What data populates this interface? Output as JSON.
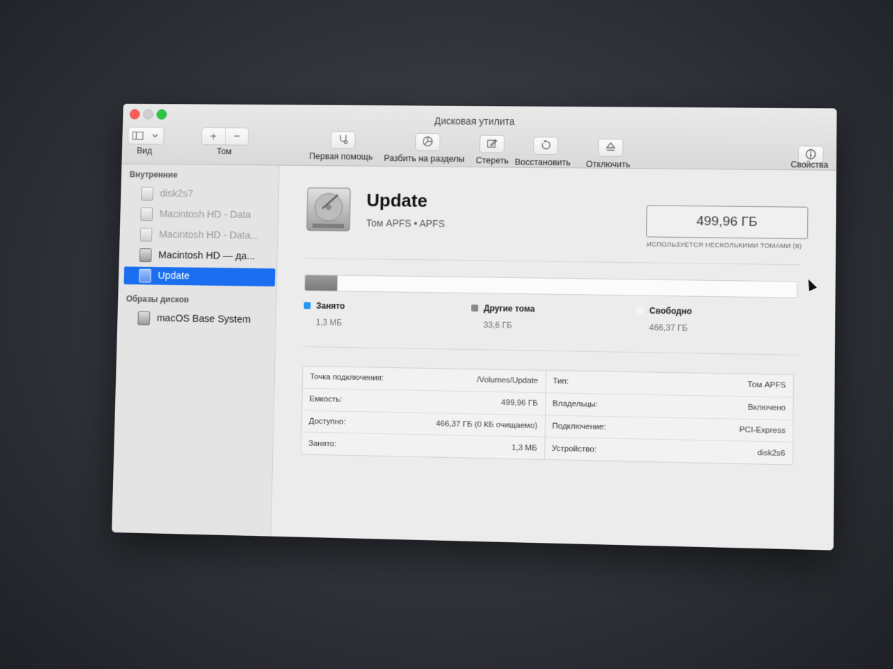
{
  "window": {
    "title": "Дисковая утилита"
  },
  "toolbar": {
    "view_label": "Вид",
    "volume_label": "Том",
    "volume_add": "+",
    "volume_remove": "−",
    "first_aid_label": "Первая помощь",
    "partition_label": "Разбить на разделы",
    "erase_label": "Стереть",
    "restore_label": "Восстановить",
    "unmount_label": "Отключить",
    "info_label": "Свойства"
  },
  "sidebar": {
    "internal_header": "Внутренние",
    "internal_items": [
      {
        "label": "disk2s7",
        "state": "dimmed"
      },
      {
        "label": "Macintosh HD - Data",
        "state": "dimmed"
      },
      {
        "label": "Macintosh HD - Data...",
        "state": "dimmed"
      },
      {
        "label": "Macintosh HD — да...",
        "state": "normal"
      },
      {
        "label": "Update",
        "state": "selected"
      }
    ],
    "images_header": "Образы дисков",
    "image_items": [
      {
        "label": "macOS Base System",
        "state": "normal"
      }
    ]
  },
  "volume": {
    "name": "Update",
    "subtitle": "Том APFS • APFS",
    "capacity": "499,96 ГБ",
    "capacity_note": "ИСПОЛЬЗУЕТСЯ НЕСКОЛЬКИМИ ТОМАМИ (8)"
  },
  "usage": {
    "other_fraction": 0.067,
    "legend": [
      {
        "title": "Занято",
        "value": "1,3 МБ",
        "color": "#2196f3"
      },
      {
        "title": "Другие тома",
        "value": "33,6 ГБ",
        "color": "#8a8a8a"
      },
      {
        "title": "Свободно",
        "value": "466,37 ГБ",
        "color": "#f4f4f4"
      }
    ]
  },
  "info": {
    "left": [
      {
        "key": "Точка подключения:",
        "value": "/Volumes/Update"
      },
      {
        "key": "Емкость:",
        "value": "499,96 ГБ"
      },
      {
        "key": "Доступно:",
        "value": "466,37 ГБ (0 КБ очищаемо)"
      },
      {
        "key": "Занято:",
        "value": "1,3 МБ"
      }
    ],
    "right": [
      {
        "key": "Тип:",
        "value": "Том APFS"
      },
      {
        "key": "Владельцы:",
        "value": "Включено"
      },
      {
        "key": "Подключение:",
        "value": "PCI-Express"
      },
      {
        "key": "Устройство:",
        "value": "disk2s6"
      }
    ]
  }
}
